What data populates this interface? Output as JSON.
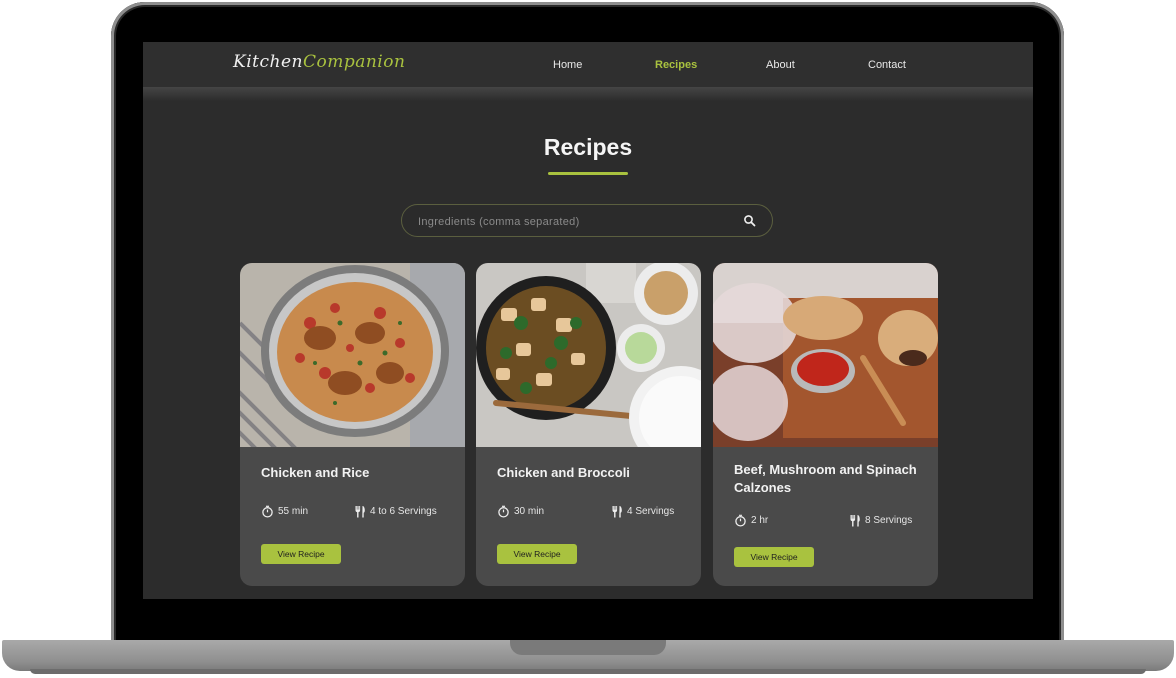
{
  "brand": {
    "part1": "Kitchen",
    "part2": "Companion"
  },
  "nav": {
    "home": "Home",
    "recipes": "Recipes",
    "about": "About",
    "contact": "Contact"
  },
  "page": {
    "title": "Recipes"
  },
  "search": {
    "placeholder": "Ingredients (comma separated)",
    "value": ""
  },
  "colors": {
    "accent": "#a9c23f",
    "background": "#2c2c2c",
    "card": "#4a4a4a"
  },
  "cards": [
    {
      "title": "Chicken and Rice",
      "time": "55 min",
      "servings": "4 to 6 Servings",
      "button": "View Recipe"
    },
    {
      "title": "Chicken and Broccoli",
      "time": "30 min",
      "servings": "4 Servings",
      "button": "View Recipe"
    },
    {
      "title": "Beef, Mushroom and Spinach Calzones",
      "time": "2 hr",
      "servings": "8 Servings",
      "button": "View Recipe"
    }
  ],
  "icons": {
    "search": "search-icon",
    "time": "stopwatch-icon",
    "servings": "fork-knife-icon"
  }
}
